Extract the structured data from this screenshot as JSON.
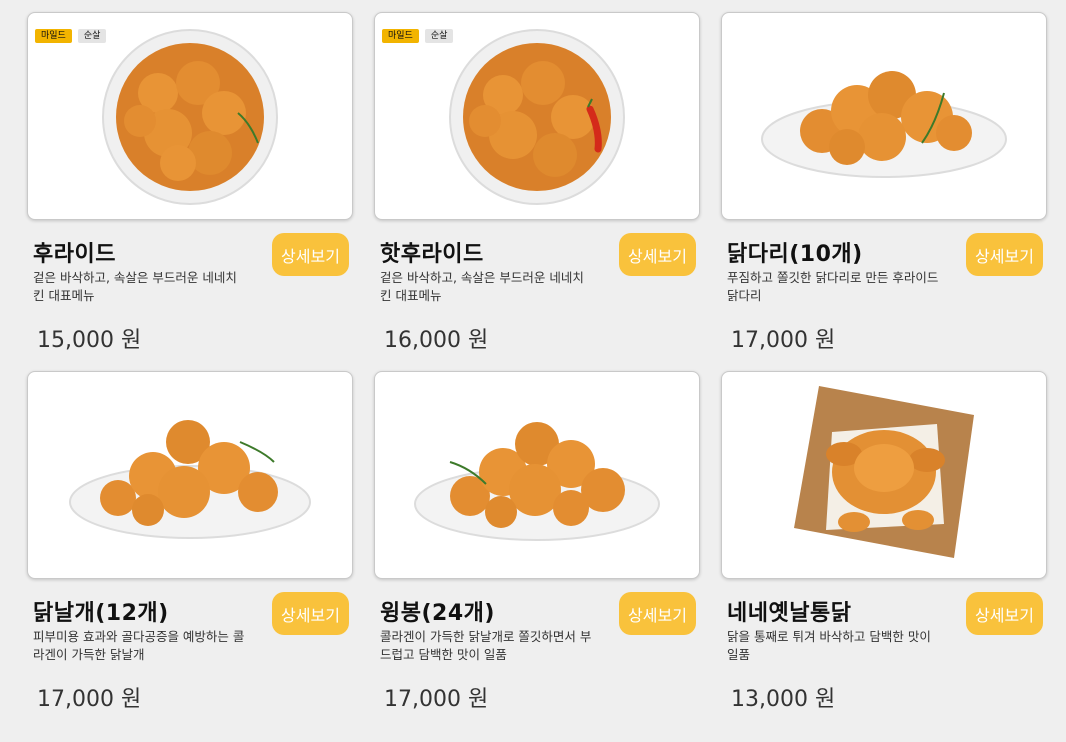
{
  "menu": [
    {
      "name": "후라이드",
      "desc": "겉은 바삭하고, 속살은 부드러운 네네치킨 대표메뉴",
      "price": "15,000 원",
      "badges": [
        "마일드",
        "순살"
      ],
      "button": "상세보기",
      "image": "fried-chicken-plate-round"
    },
    {
      "name": "핫후라이드",
      "desc": "겉은 바삭하고, 속살은 부드러운 네네치킨 대표메뉴",
      "price": "16,000 원",
      "badges": [
        "마일드",
        "순살"
      ],
      "button": "상세보기",
      "image": "hot-fried-chicken-plate-round"
    },
    {
      "name": "닭다리(10개)",
      "desc": "푸짐하고 쫄깃한 닭다리로 만든 후라이드 닭다리",
      "price": "17,000 원",
      "badges": [],
      "button": "상세보기",
      "image": "drumsticks-plate-oval"
    },
    {
      "name": "닭날개(12개)",
      "desc": "피부미용 효과와 골다공증을 예방하는 콜라겐이 가득한 닭날개",
      "price": "17,000 원",
      "badges": [],
      "button": "상세보기",
      "image": "wings-plate-oval"
    },
    {
      "name": "윙봉(24개)",
      "desc": "콜라겐이 가득한 닭날개로 쫄깃하면서 부드럽고 담백한 맛이 일품",
      "price": "17,000 원",
      "badges": [],
      "button": "상세보기",
      "image": "wingbong-plate-oval"
    },
    {
      "name": "네네옛날통닭",
      "desc": "닭을 통째로 튀겨 바삭하고 담백한 맛이 일품",
      "price": "13,000 원",
      "badges": [],
      "button": "상세보기",
      "image": "whole-chicken-wood-board"
    }
  ],
  "colors": {
    "page_bg": "#efefef",
    "button_bg": "#f9c23c",
    "badge_mild": "#f2b400",
    "badge_boneless": "#e4e4e4",
    "chicken": "#e08a2c"
  }
}
